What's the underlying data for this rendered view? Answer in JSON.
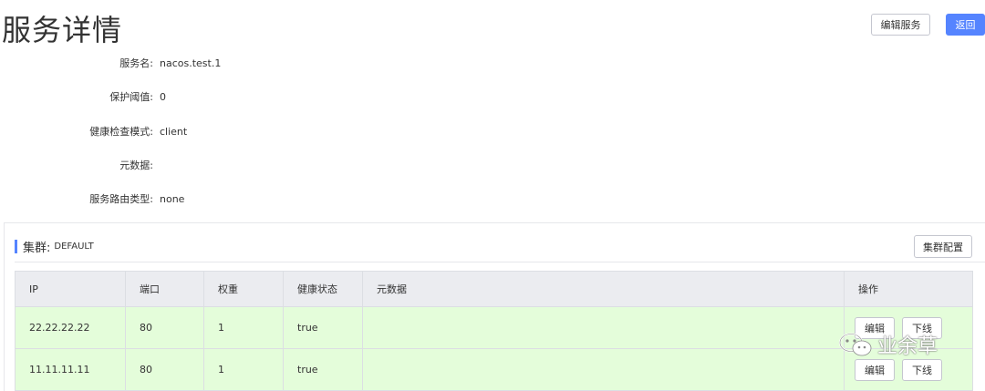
{
  "header": {
    "title": "服务详情",
    "edit_service_label": "编辑服务",
    "back_label": "返回"
  },
  "service_info": [
    {
      "label": "服务名:",
      "value": "nacos.test.1"
    },
    {
      "label": "保护阈值:",
      "value": "0"
    },
    {
      "label": "健康检查模式:",
      "value": "client"
    },
    {
      "label": "元数据:",
      "value": ""
    },
    {
      "label": "服务路由类型:",
      "value": "none"
    }
  ],
  "cluster": {
    "title": "集群:",
    "name": "DEFAULT",
    "config_label": "集群配置",
    "columns": [
      "IP",
      "端口",
      "权重",
      "健康状态",
      "元数据",
      "操作"
    ],
    "rows": [
      {
        "ip": "22.22.22.22",
        "port": "80",
        "weight": "1",
        "healthy": "true",
        "metadata": "",
        "edit_label": "编辑",
        "offline_label": "下线"
      },
      {
        "ip": "11.11.11.11",
        "port": "80",
        "weight": "1",
        "healthy": "true",
        "metadata": "",
        "edit_label": "编辑",
        "offline_label": "下线"
      }
    ]
  },
  "watermark": {
    "text": "业余草",
    "icon": "wechat-icon"
  },
  "colors": {
    "primary": "#5584ff",
    "row_background": "#e4fdda",
    "header_background": "#ebecf0"
  }
}
